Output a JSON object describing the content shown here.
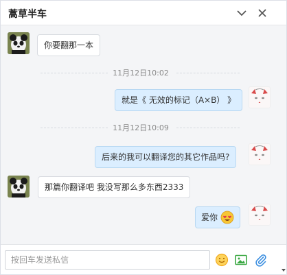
{
  "header": {
    "title": "蒿草半车",
    "minimize_icon": "chevron-down-icon",
    "close_icon": "close-icon"
  },
  "messages": [
    {
      "side": "left",
      "text": "你要翻那一本"
    },
    {
      "timestamp": "11月12日10:02"
    },
    {
      "side": "right",
      "text": "就是《 无效的标记（A×B） 》"
    },
    {
      "timestamp": "11月12日10:09"
    },
    {
      "side": "right",
      "text": "后来的我可以翻译您的其它作品吗?"
    },
    {
      "side": "left",
      "text": "那篇你翻译吧 我没写那么多东西2333"
    },
    {
      "side": "right",
      "text": "爱你",
      "emoji": "heart-eyes-emoji"
    }
  ],
  "composer": {
    "placeholder": "按回车发送私信",
    "icons": [
      "emoji-icon",
      "image-icon",
      "attachment-icon"
    ]
  },
  "colors": {
    "accent": "#f5a623",
    "sent_bubble": "#dbeeff",
    "received_bubble": "#ffffff",
    "image_icon": "#3aa842",
    "attach_icon": "#3c8fe0"
  }
}
